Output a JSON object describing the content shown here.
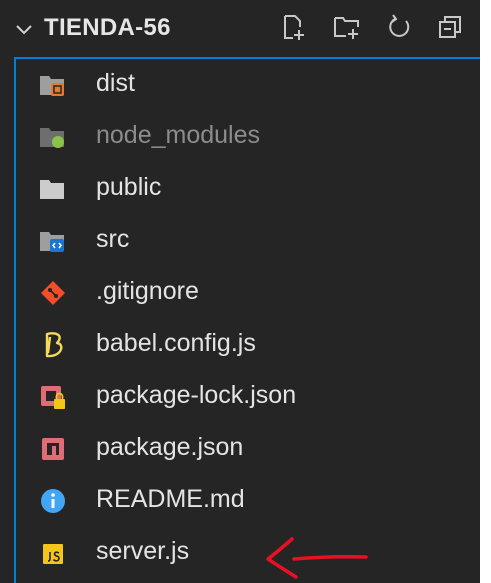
{
  "explorer": {
    "title": "TIENDA-56",
    "header_icons": [
      "new-file-icon",
      "new-folder-icon",
      "refresh-icon",
      "collapse-all-icon"
    ],
    "items": [
      {
        "label": "dist",
        "kind": "folder",
        "icon": "folder-dist-icon",
        "color": "#e37933",
        "dimmed": false
      },
      {
        "label": "node_modules",
        "kind": "folder",
        "icon": "folder-node-icon",
        "color": "#8bc34a",
        "dimmed": true
      },
      {
        "label": "public",
        "kind": "folder",
        "icon": "folder-icon",
        "color": "#cccccc",
        "dimmed": false
      },
      {
        "label": "src",
        "kind": "folder",
        "icon": "folder-src-icon",
        "color": "#42a5f5",
        "dimmed": false
      },
      {
        "label": ".gitignore",
        "kind": "file",
        "icon": "git-icon",
        "color": "#f44d27",
        "dimmed": false
      },
      {
        "label": "babel.config.js",
        "kind": "file",
        "icon": "babel-icon",
        "color": "#f5da55",
        "dimmed": false
      },
      {
        "label": "package-lock.json",
        "kind": "file",
        "icon": "npm-lock-icon",
        "color": "#e06c75",
        "dimmed": false
      },
      {
        "label": "package.json",
        "kind": "file",
        "icon": "npm-icon",
        "color": "#e06c75",
        "dimmed": false
      },
      {
        "label": "README.md",
        "kind": "file",
        "icon": "info-icon",
        "color": "#42a5f5",
        "dimmed": false
      },
      {
        "label": "server.js",
        "kind": "file",
        "icon": "js-icon",
        "color": "#f5c518",
        "dimmed": false
      }
    ]
  },
  "colors": {
    "panel_bg": "#252526",
    "focus_border": "#007fd4",
    "annotation_arrow": "#e81123"
  }
}
